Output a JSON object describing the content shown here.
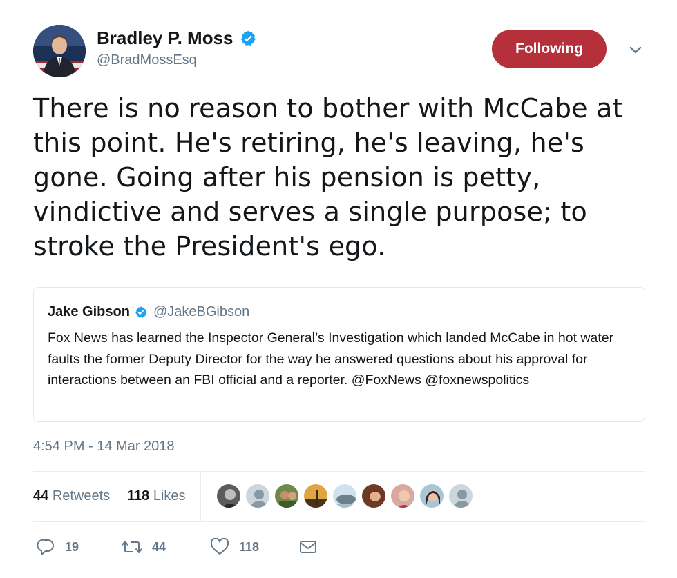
{
  "author": {
    "name": "Bradley P. Moss",
    "handle": "@BradMossEsq",
    "verified_icon": "verified-badge-icon",
    "avatar_icon": "profile-photo"
  },
  "follow_button": {
    "label": "Following",
    "color": "#b5303a"
  },
  "menu": {
    "icon": "chevron-down-icon"
  },
  "tweet": {
    "text": "There is no reason to bother with McCabe at this point. He's retiring, he's leaving, he's gone. Going after his pension is petty, vindictive and serves a single purpose; to stroke the President's ego."
  },
  "quoted_tweet": {
    "name": "Jake Gibson",
    "handle": "@JakeBGibson",
    "text": "Fox News has learned the Inspector General’s Investigation which landed McCabe in hot water faults the former Deputy Director for the way he answered questions about his approval for interactions between an FBI official and a reporter. @FoxNews @foxnewspolitics"
  },
  "timestamp": "4:54 PM - 14 Mar 2018",
  "stats": {
    "retweets_count": "44",
    "retweets_label": "Retweets",
    "likes_count": "118",
    "likes_label": "Likes"
  },
  "actions": {
    "reply_count": "19",
    "retweet_count": "44",
    "like_count": "118",
    "reply_icon": "reply-icon",
    "retweet_icon": "retweet-icon",
    "like_icon": "heart-icon",
    "message_icon": "envelope-icon"
  },
  "colors": {
    "accent": "#1da1f2",
    "muted": "#657786",
    "text": "#14171a"
  }
}
